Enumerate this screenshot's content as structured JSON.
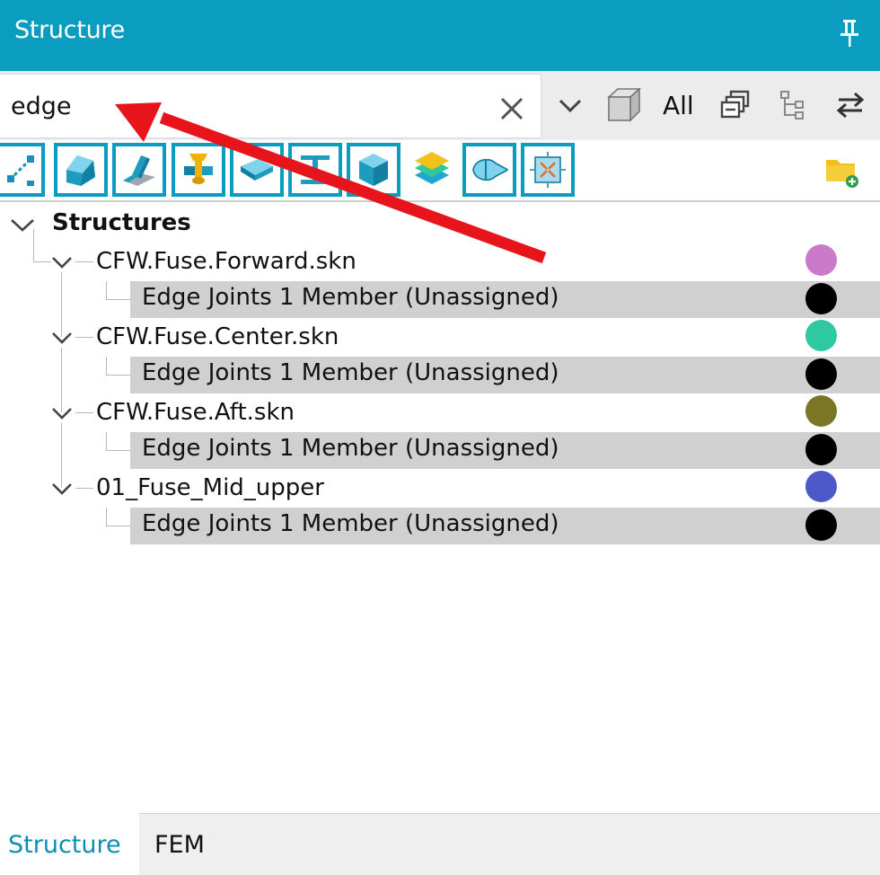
{
  "window": {
    "title": "Structure"
  },
  "search": {
    "value": "edge",
    "filter_label": "All"
  },
  "toolbar": {
    "filter_buttons": [
      "nodes",
      "surface",
      "angle",
      "fastener",
      "panel",
      "beam",
      "solid",
      "layers",
      "airfoil",
      "zone"
    ]
  },
  "tree": {
    "root_label": "Structures",
    "nodes": [
      {
        "label": "CFW.Fuse.Forward.skn",
        "color": "#c97ac9",
        "child": {
          "label": "Edge Joints 1 Member (Unassigned)",
          "color": "#000000"
        }
      },
      {
        "label": "CFW.Fuse.Center.skn",
        "color": "#2ec9a0",
        "child": {
          "label": "Edge Joints 1 Member (Unassigned)",
          "color": "#000000"
        }
      },
      {
        "label": "CFW.Fuse.Aft.skn",
        "color": "#7a7626",
        "child": {
          "label": "Edge Joints 1 Member (Unassigned)",
          "color": "#000000"
        }
      },
      {
        "label": "01_Fuse_Mid_upper",
        "color": "#4d58c9",
        "child": {
          "label": "Edge Joints 1 Member (Unassigned)",
          "color": "#000000"
        }
      }
    ]
  },
  "tabs": {
    "active": "Structure",
    "items": [
      "Structure",
      "FEM"
    ]
  },
  "colors": {
    "accent": "#0a9dc0",
    "annotation_arrow": "#e8141b"
  }
}
